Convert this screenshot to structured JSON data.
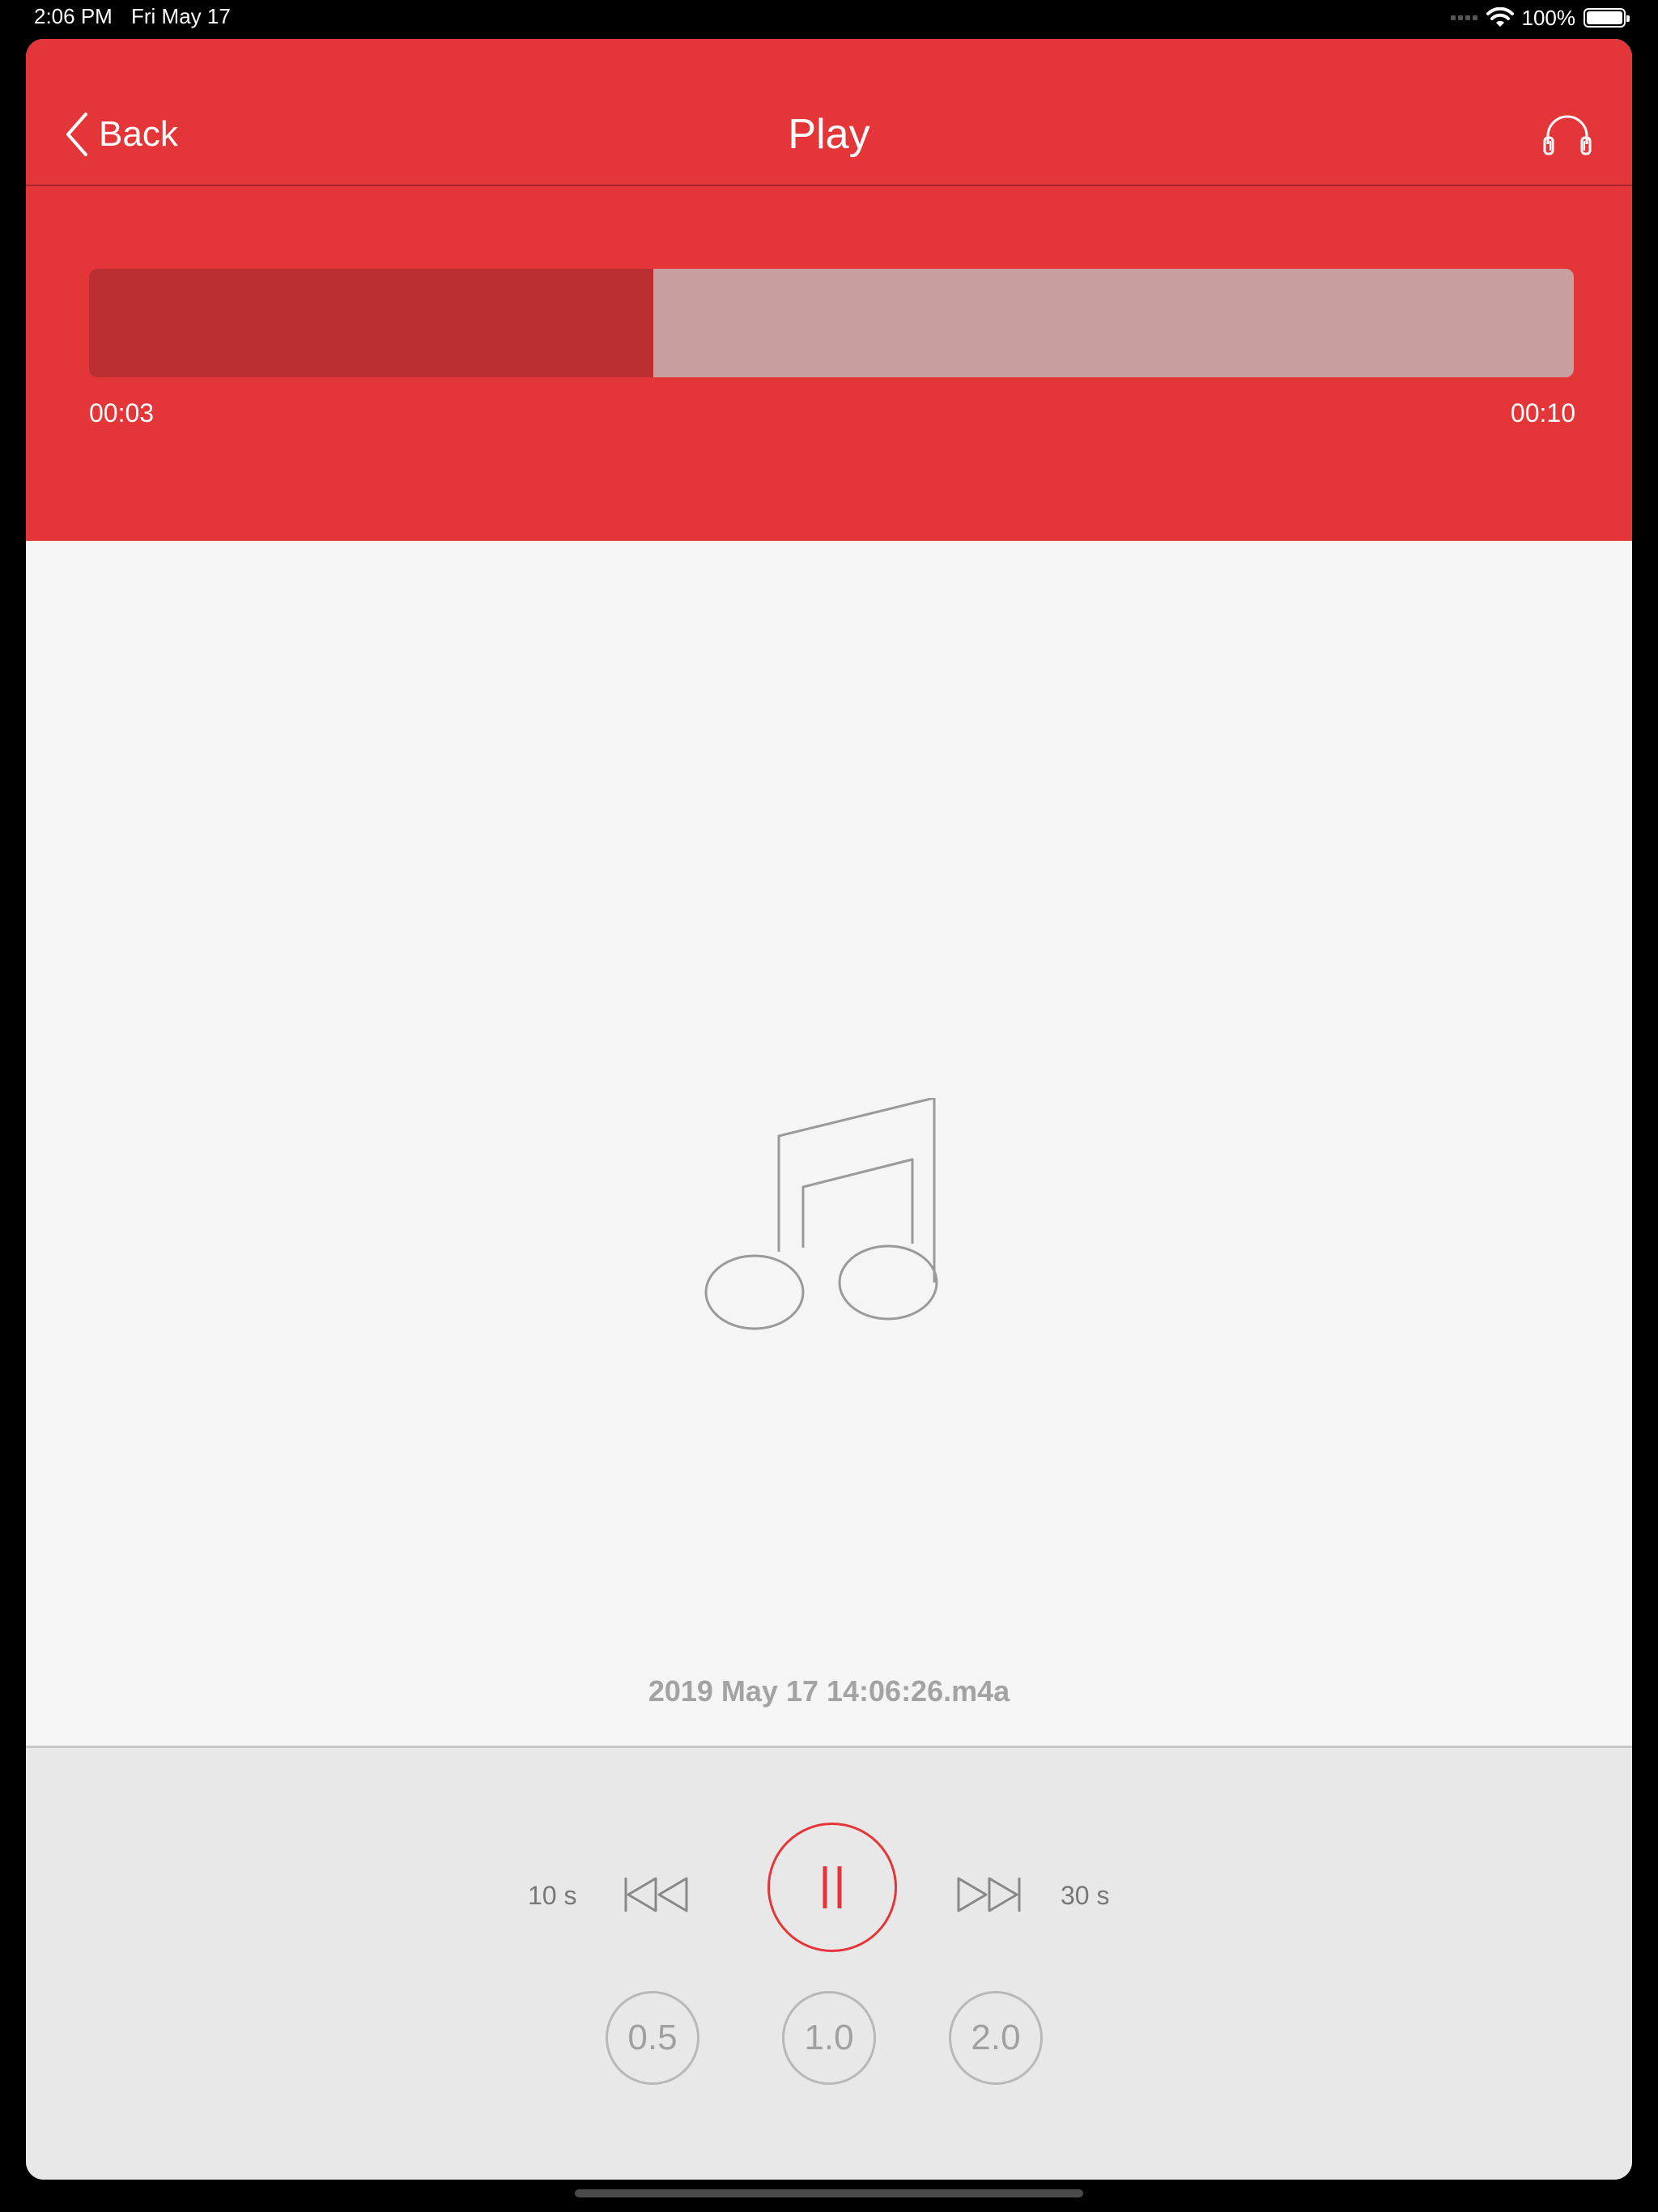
{
  "status_bar": {
    "time": "2:06 PM",
    "date": "Fri May 17",
    "battery": "100%",
    "icons": [
      "signal-icon",
      "wifi-icon",
      "battery-icon"
    ]
  },
  "nav": {
    "back_label": "Back",
    "title": "Play",
    "right_icon": "headphones-icon"
  },
  "playback": {
    "elapsed": "00:03",
    "total": "00:10",
    "progress_fraction": 0.38
  },
  "file": {
    "name": "2019 May 17 14:06:26.m4a"
  },
  "controls": {
    "skip_back_label": "10 s",
    "skip_forward_label": "30 s",
    "speeds": [
      "0.5",
      "1.0",
      "2.0"
    ]
  },
  "colors": {
    "accent": "#e43639",
    "progress_fill": "#bb2e32",
    "progress_track": "#c79f9f",
    "background": "#f5f5f5",
    "controls_background": "#e8e8e8"
  }
}
